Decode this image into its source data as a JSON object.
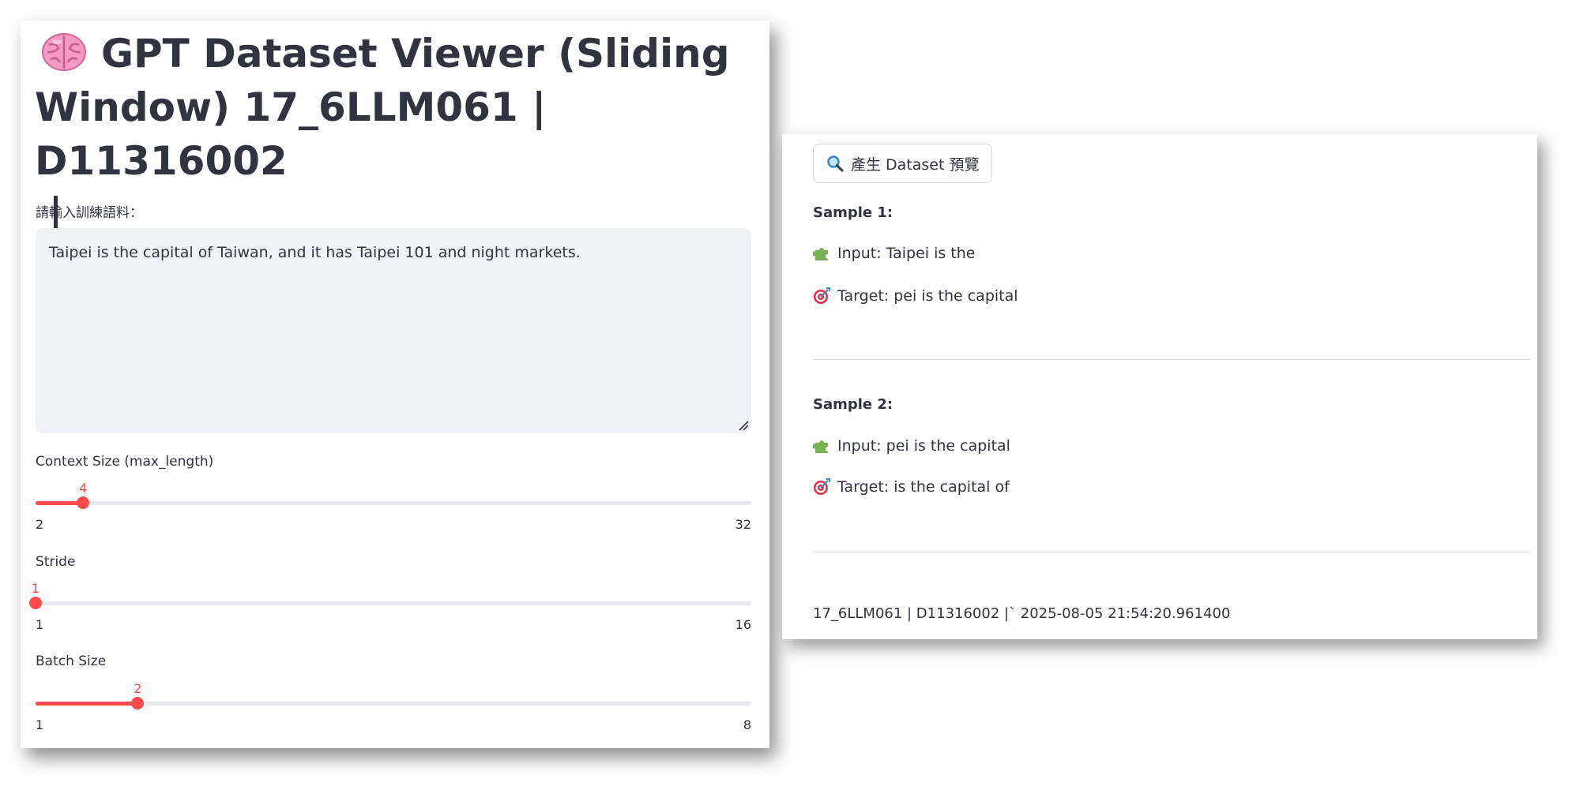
{
  "left_panel": {
    "title_line1": "GPT Dataset Viewer (Sliding",
    "title_line2": "Window) 17_6LLM061 | D11316002",
    "title_icon": "brain-icon",
    "input_label": "請輸入訓練語料：",
    "input_value": "Taipei is the capital of Taiwan, and it has Taipei 101 and night markets.",
    "sliders": [
      {
        "label": "Context Size (max_length)",
        "value": 4,
        "min": 2,
        "max": 32
      },
      {
        "label": "Stride",
        "value": 1,
        "min": 1,
        "max": 16
      },
      {
        "label": "Batch Size",
        "value": 2,
        "min": 1,
        "max": 8
      }
    ],
    "accent_color": "#ff4b4b"
  },
  "right_panel": {
    "button_label": "產生 Dataset 預覽",
    "button_icon": "magnifier-icon",
    "samples": [
      {
        "title": "Sample 1:",
        "input": "Input: Taipei is the",
        "target": "Target: pei is the capital"
      },
      {
        "title": "Sample 2:",
        "input": "Input: pei is the capital",
        "target": "Target: is the capital of"
      }
    ],
    "footer": "17_6LLM061 | D11316002 |` 2025-08-05 21:54:20.961400"
  }
}
